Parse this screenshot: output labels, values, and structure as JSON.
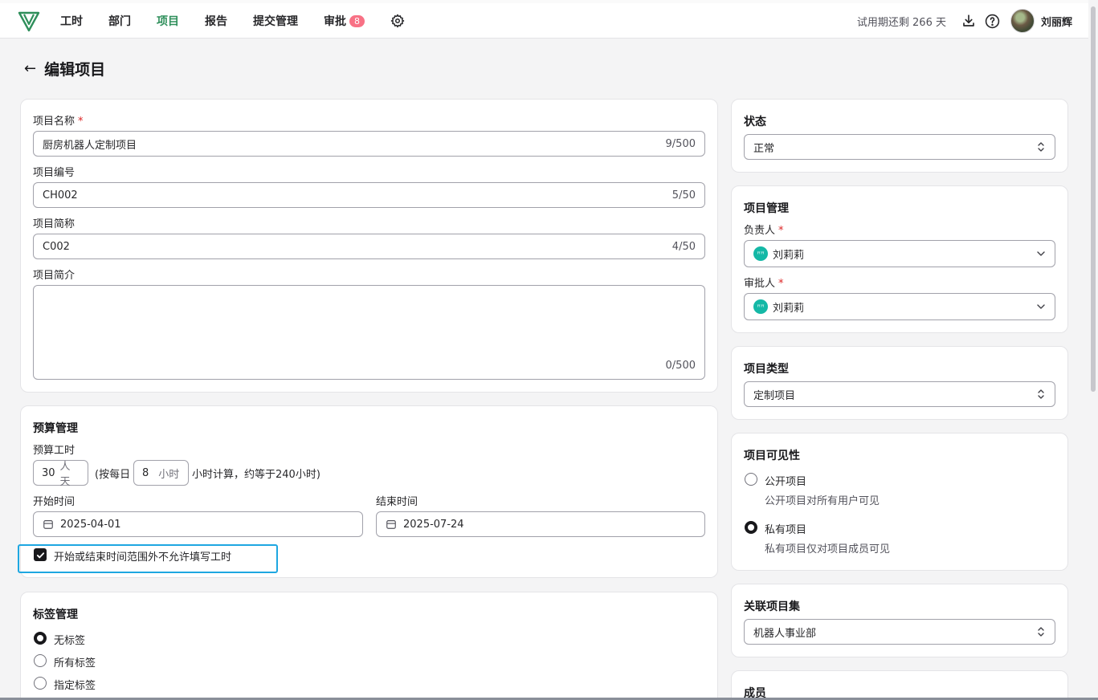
{
  "nav": {
    "items": [
      {
        "label": "工时"
      },
      {
        "label": "部门"
      },
      {
        "label": "项目",
        "active": true
      },
      {
        "label": "报告"
      },
      {
        "label": "提交管理"
      },
      {
        "label": "审批",
        "badge": "8"
      }
    ],
    "trial_text": "试用期还剩 266 天",
    "username": "刘丽辉",
    "accent_color": "#2f8f5b",
    "badge_color": "#f87185"
  },
  "page": {
    "title": "编辑项目",
    "back_icon": "←"
  },
  "basic": {
    "name_label": "项目名称",
    "name_value": "厨房机器人定制项目",
    "name_counter": "9/500",
    "code_label": "项目编号",
    "code_value": "CH002",
    "code_counter": "5/50",
    "short_label": "项目简称",
    "short_value": "C002",
    "short_counter": "4/50",
    "desc_label": "项目简介",
    "desc_value": "",
    "desc_counter": "0/500",
    "required_mark": "*"
  },
  "budget": {
    "title": "预算管理",
    "hours_label": "预算工时",
    "days_value": "30",
    "days_unit": "人天",
    "text_before": "(按每日",
    "hours_per_day": "8",
    "hours_unit": "小时",
    "text_after": "小时计算，约等于240小时)",
    "start_label": "开始时间",
    "start_value": "2025-04-01",
    "end_label": "结束时间",
    "end_value": "2025-07-24",
    "restrict_label": "开始或结束时间范围外不允许填写工时",
    "restrict_checked": true
  },
  "tags": {
    "title": "标签管理",
    "options": [
      {
        "label": "无标签",
        "checked": true
      },
      {
        "label": "所有标签",
        "checked": false
      },
      {
        "label": "指定标签",
        "checked": false
      }
    ]
  },
  "status": {
    "title": "状态",
    "value": "正常"
  },
  "management": {
    "title": "项目管理",
    "owner_label": "负责人",
    "owner_value": "刘莉莉",
    "approver_label": "审批人",
    "approver_value": "刘莉莉",
    "avatar_text": "ꟸꟸ"
  },
  "type": {
    "title": "项目类型",
    "value": "定制项目"
  },
  "visibility": {
    "title": "项目可见性",
    "public_label": "公开项目",
    "public_desc": "公开项目对所有用户可见",
    "private_label": "私有项目",
    "private_desc": "私有项目仅对项目成员可见",
    "selected": "private"
  },
  "collection": {
    "title": "关联项目集",
    "value": "机器人事业部"
  },
  "members": {
    "title": "成员"
  }
}
